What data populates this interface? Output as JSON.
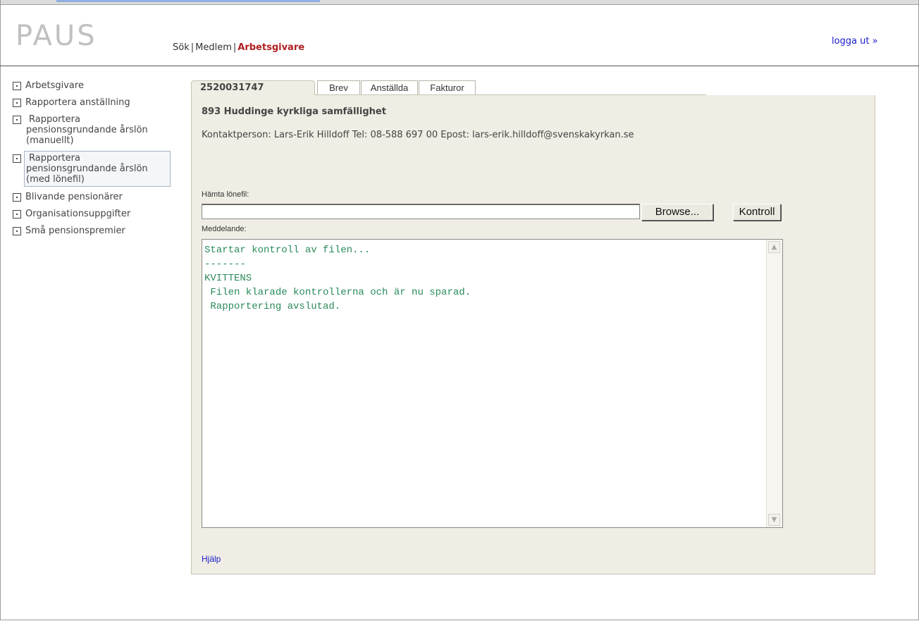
{
  "header": {
    "logo": "PAUS",
    "nav": [
      {
        "label": "Sök"
      },
      {
        "label": "Medlem"
      },
      {
        "label": "Arbetsgivare"
      }
    ],
    "logout": "logga ut »"
  },
  "sidebar": {
    "items": [
      {
        "label": "Arbetsgivare"
      },
      {
        "label": "Rapportera anställning"
      },
      {
        "label": "Rapportera pensionsgrundande årslön (manuellt)"
      },
      {
        "label": "Rapportera pensionsgrundande årslön (med lönefil)"
      },
      {
        "label": "Blivande pensionärer"
      },
      {
        "label": "Organisationsuppgifter"
      },
      {
        "label": "Små pensionspremier"
      }
    ]
  },
  "tabs": {
    "main": "2520031747",
    "items": [
      {
        "label": "Brev"
      },
      {
        "label": "Anställda"
      },
      {
        "label": "Fakturor"
      }
    ]
  },
  "panel": {
    "org_name": "893 Huddinge kyrkliga samfällighet",
    "contact": "Kontaktperson: Lars-Erik Hilldoff Tel: 08-588 697 00 Epost: lars-erik.hilldoff@svenskakyrkan.se",
    "file_label": "Hämta lönefil:",
    "file_value": "",
    "browse_label": "Browse...",
    "check_label": "Kontroll",
    "message_label": "Meddelande:",
    "message_text": "Startar kontroll av filen...\n-------\nKVITTENS\n Filen klarade kontrollerna och är nu sparad.\n Rapportering avslutad.",
    "help_link": "Hjälp"
  },
  "colors": {
    "panel_bg": "#f0ede4",
    "active_nav": "#b02020",
    "link": "#1a1acc",
    "message_text": "#2a8a5a"
  }
}
